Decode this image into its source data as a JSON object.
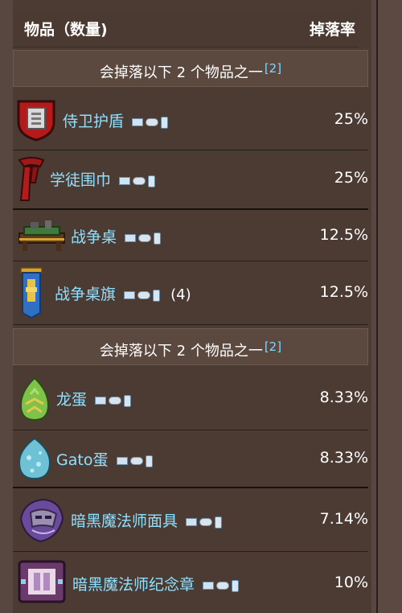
{
  "header": {
    "item_col": "物品（数量)",
    "rate_col": "掉落率"
  },
  "groups": [
    {
      "text": "会掉落以下 2 个物品之一",
      "ref": "[2]"
    },
    {
      "text": "会掉落以下 2 个物品之一",
      "ref": "[2]"
    }
  ],
  "items": [
    {
      "name": "侍卫护盾",
      "count": "",
      "rate": "25%",
      "icon": "shield-icon"
    },
    {
      "name": "学徒围巾",
      "count": "",
      "rate": "25%",
      "icon": "scarf-icon"
    },
    {
      "name": "战争桌",
      "count": "",
      "rate": "12.5%",
      "icon": "war-table-icon"
    },
    {
      "name": "战争桌旗",
      "count": "(4)",
      "rate": "12.5%",
      "icon": "war-banner-icon"
    },
    {
      "name": "龙蛋",
      "count": "",
      "rate": "8.33%",
      "icon": "dragon-egg-icon"
    },
    {
      "name": "Gato蛋",
      "count": "",
      "rate": "8.33%",
      "icon": "gato-egg-icon"
    },
    {
      "name": "暗黑魔法师面具",
      "count": "",
      "rate": "7.14%",
      "icon": "dark-mage-mask-icon"
    },
    {
      "name": "暗黑魔法师纪念章",
      "count": "",
      "rate": "10%",
      "icon": "dark-mage-medal-icon"
    }
  ],
  "platform_icons": [
    "pc-icon",
    "console-icon",
    "mobile-icon"
  ],
  "colors": {
    "link": "#8fe0ff",
    "ref": "#7fd6ff",
    "text": "#ffffff",
    "bg": "#4b3b33"
  }
}
